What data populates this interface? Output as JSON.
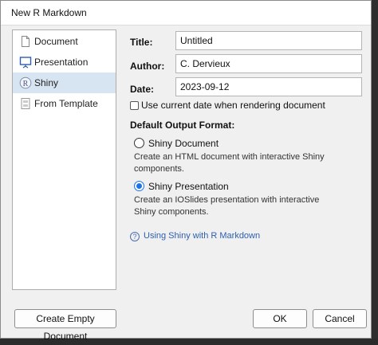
{
  "window": {
    "title": "New R Markdown"
  },
  "sidebar": {
    "items": [
      {
        "label": "Document",
        "selected": false,
        "icon": "document-icon"
      },
      {
        "label": "Presentation",
        "selected": false,
        "icon": "presentation-icon"
      },
      {
        "label": "Shiny",
        "selected": true,
        "icon": "r-logo-icon"
      },
      {
        "label": "From Template",
        "selected": false,
        "icon": "template-icon"
      }
    ]
  },
  "form": {
    "title_label": "Title:",
    "title_value": "Untitled",
    "author_label": "Author:",
    "author_value": "C. Dervieux",
    "date_label": "Date:",
    "date_value": "2023-09-12",
    "use_current_date_label": "Use current date when rendering document",
    "use_current_date_checked": false
  },
  "output": {
    "section_label": "Default Output Format:",
    "options": [
      {
        "title": "Shiny Document",
        "description": "Create an HTML document with interactive Shiny components.",
        "selected": false
      },
      {
        "title": "Shiny Presentation",
        "description": "Create an IOSlides presentation with interactive Shiny components.",
        "selected": true
      }
    ]
  },
  "help": {
    "icon": "question-circle-icon",
    "link_text": "Using Shiny with R Markdown"
  },
  "buttons": {
    "create_empty": "Create Empty Document",
    "ok": "OK",
    "cancel": "Cancel"
  },
  "background": {
    "file_name": "shiny_scss"
  },
  "colors": {
    "accent": "#1a73e8",
    "selected_bg": "#d7e4f2",
    "link": "#2d5fb0"
  }
}
